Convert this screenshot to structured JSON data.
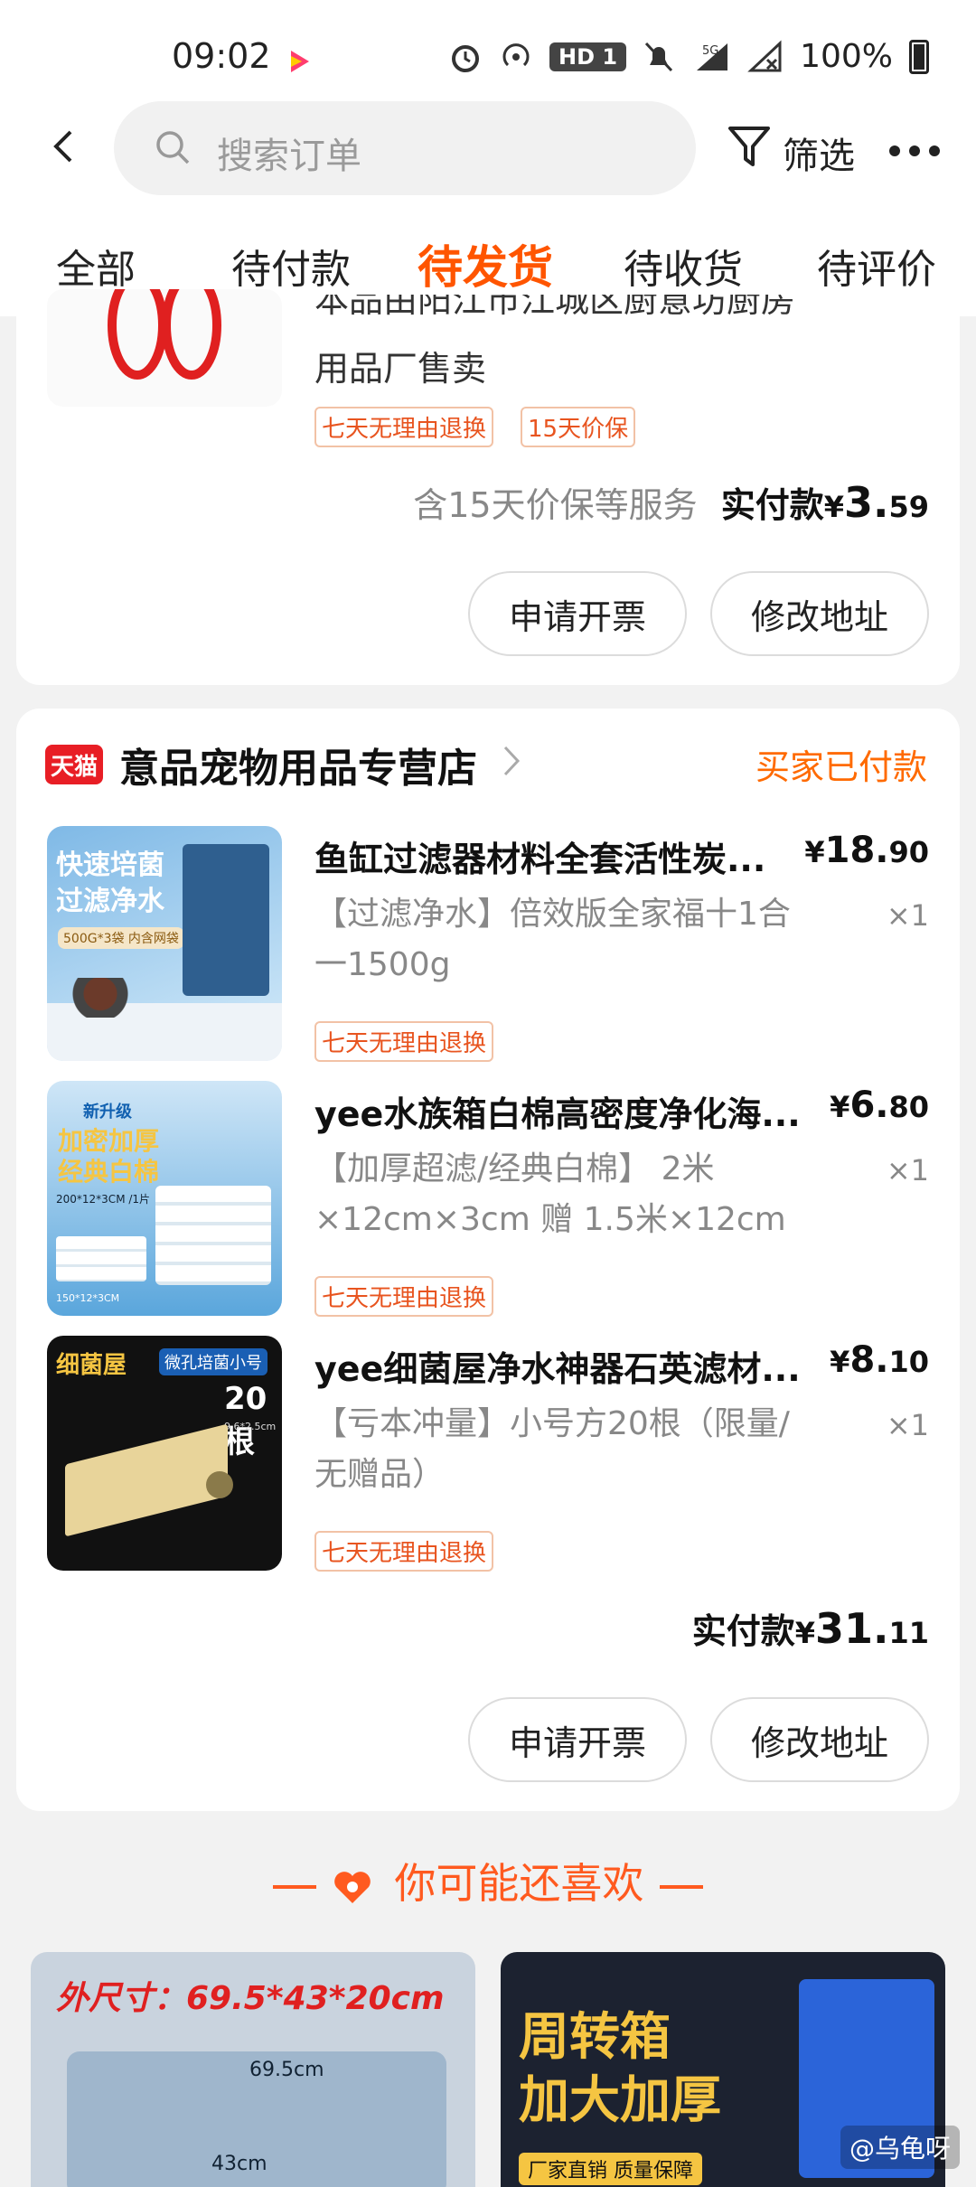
{
  "status_bar": {
    "time": "09:02",
    "hd_badge": "HD 1",
    "signal": "5G",
    "battery": "100%"
  },
  "header": {
    "search_placeholder": "搜索订单",
    "filter_label": "筛选"
  },
  "tabs": [
    {
      "label": "全部",
      "active": false
    },
    {
      "label": "待付款",
      "active": false
    },
    {
      "label": "待发货",
      "active": true
    },
    {
      "label": "待收货",
      "active": false
    },
    {
      "label": "待评价",
      "active": false
    }
  ],
  "order1": {
    "desc_line1": "本品由阳江市江城区厨意坊厨房",
    "desc_line2": "用品厂售卖",
    "tags": [
      "七天无理由退换",
      "15天价保"
    ],
    "service_note": "含15天价保等服务",
    "paid_label": "实付款",
    "currency": "¥",
    "amount_int": "3.",
    "amount_dec": "59",
    "buttons": [
      "申请开票",
      "修改地址"
    ]
  },
  "order2": {
    "platform": "天猫",
    "shop_name": "意品宠物用品专营店",
    "status": "买家已付款",
    "items": [
      {
        "title": "鱼缸过滤器材料全套活性炭...",
        "spec": "【过滤净水】倍效版全家福十1合一1500g",
        "tag": "七天无理由退换",
        "price_int": "18.",
        "price_dec": "90",
        "qty": "×1",
        "thumb_text": [
          "快速培菌",
          "过滤净水",
          "500G*3袋 内含网袋"
        ]
      },
      {
        "title": "yee水族箱白棉高密度净化海...",
        "spec": "【加厚超滤/经典白棉】 2米×12cm×3cm 赠 1.5米×12cm",
        "tag": "七天无理由退换",
        "price_int": "6.",
        "price_dec": "80",
        "qty": "×1",
        "thumb_text": [
          "新升级",
          "加密加厚",
          "经典白棉",
          "200*12*3CM /1片",
          "150*12*3CM"
        ]
      },
      {
        "title": "yee细菌屋净水神器石英滤材...",
        "spec": "【亏本冲量】小号方20根（限量/无赠品）",
        "tag": "七天无理由退换",
        "price_int": "8.",
        "price_dec": "10",
        "qty": "×1",
        "thumb_text": [
          "细菌屋",
          "微孔培菌小号",
          "20根",
          "9.6*2.5cm"
        ]
      }
    ],
    "paid_label": "实付款",
    "currency": "¥",
    "amount_int": "31.",
    "amount_dec": "11",
    "buttons": [
      "申请开票",
      "修改地址"
    ]
  },
  "recommend": {
    "title": "你可能还喜欢",
    "card1_text": [
      "外尺寸：69.5*43*20cm",
      "69.5cm",
      "43cm"
    ],
    "card2_text": [
      "周转箱",
      "加大加厚",
      "厂家直销 质量保障"
    ]
  },
  "watermark": "@乌龟呀"
}
